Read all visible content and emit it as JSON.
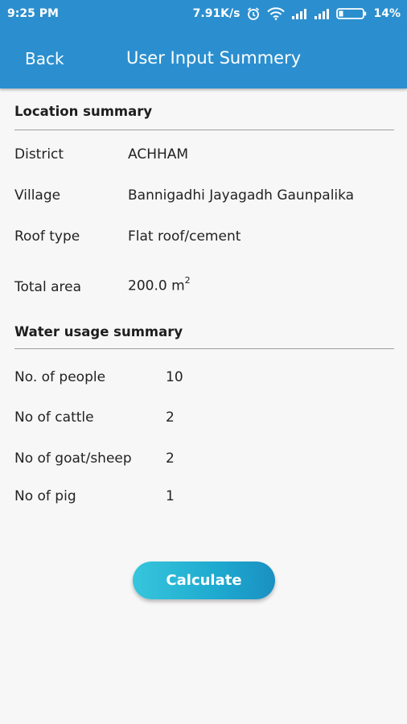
{
  "status_bar": {
    "time": "9:25 PM",
    "network_speed": "7.91K/s",
    "battery": "14%",
    "icons": [
      "alarm-icon",
      "wifi-icon",
      "signal-icon",
      "signal-icon",
      "battery-icon"
    ]
  },
  "app_bar": {
    "back_label": "Back",
    "title": "User Input Summery",
    "color": "#2b8fcf"
  },
  "location_summary": {
    "heading": "Location summary",
    "rows": [
      {
        "label": "District",
        "value": "ACHHAM"
      },
      {
        "label": "Village",
        "value": "Bannigadhi Jayagadh Gaunpalika"
      },
      {
        "label": "Roof type",
        "value": "Flat roof/cement"
      },
      {
        "label": "Total area",
        "value": "200.0 m",
        "unit_sup": "2"
      }
    ]
  },
  "water_usage_summary": {
    "heading": "Water usage summary",
    "rows": [
      {
        "label": "No. of  people",
        "value": "10"
      },
      {
        "label": "No of cattle",
        "value": "2"
      },
      {
        "label": "No of goat/sheep",
        "value": "2"
      },
      {
        "label": "No of pig",
        "value": "1"
      }
    ]
  },
  "calculate_button": {
    "label": "Calculate",
    "color": "#1ea9cf"
  }
}
